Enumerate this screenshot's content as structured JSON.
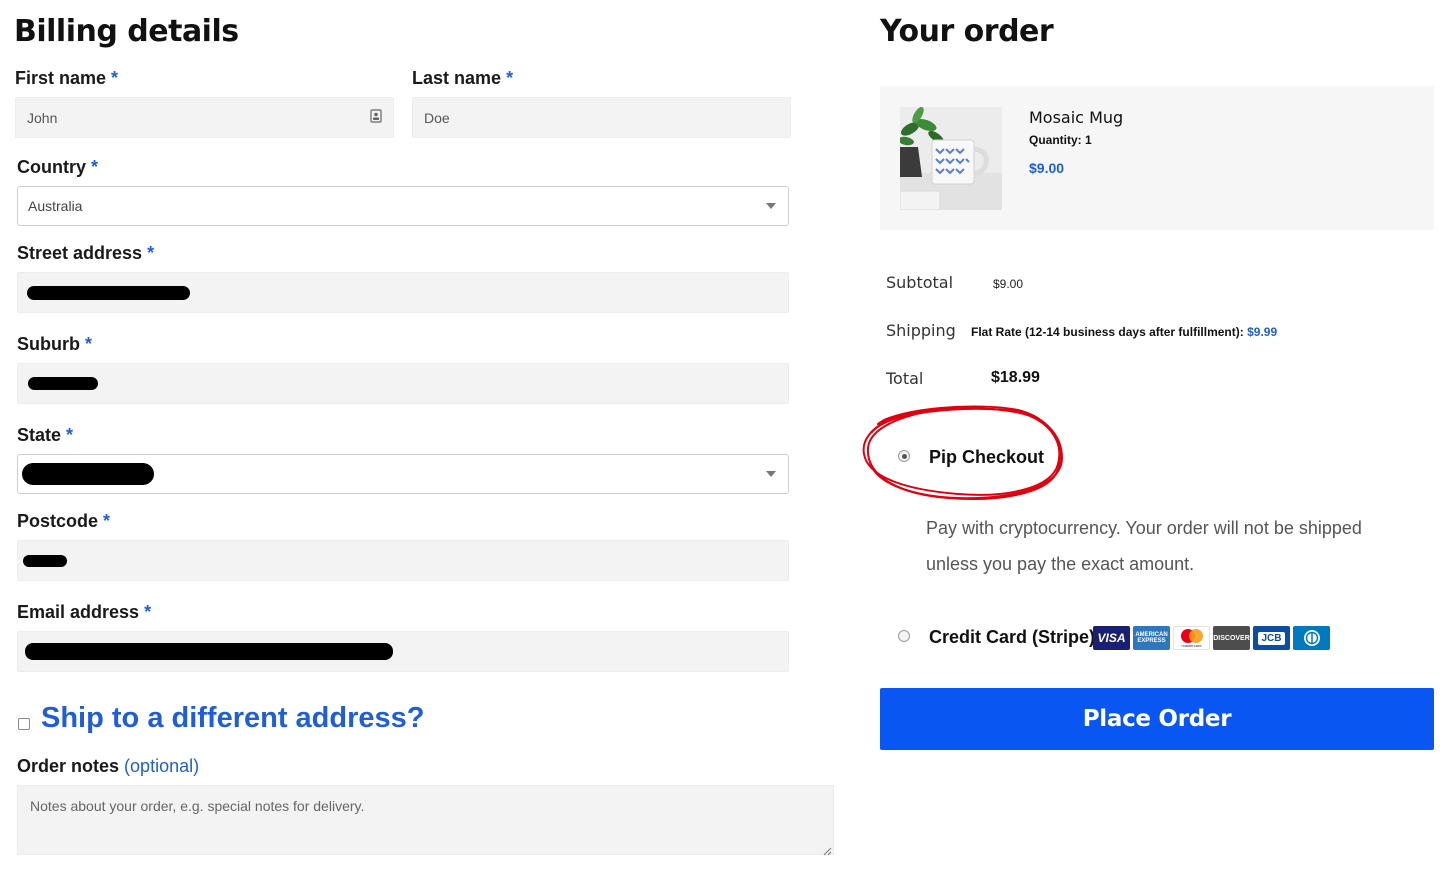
{
  "billing": {
    "title": "Billing details",
    "required_mark": "*",
    "first_name": {
      "label": "First name",
      "value": "John"
    },
    "last_name": {
      "label": "Last name",
      "value": "Doe"
    },
    "country": {
      "label": "Country",
      "value": "Australia"
    },
    "street": {
      "label": "Street address"
    },
    "suburb": {
      "label": "Suburb"
    },
    "state": {
      "label": "State"
    },
    "postcode": {
      "label": "Postcode"
    },
    "email": {
      "label": "Email address"
    },
    "ship_different": "Ship to a different address?",
    "order_notes": {
      "label": "Order notes",
      "optional": "(optional)",
      "placeholder": "Notes about your order, e.g. special notes for delivery."
    }
  },
  "order": {
    "title": "Your order",
    "product": {
      "name": "Mosaic Mug",
      "quantity": "Quantity: 1",
      "price": "$9.00"
    },
    "subtotal": {
      "label": "Subtotal",
      "value": "$9.00"
    },
    "shipping": {
      "label": "Shipping",
      "method": "Flat Rate (12-14 business days after fulfillment):",
      "price": "$9.99"
    },
    "total": {
      "label": "Total",
      "value": "$18.99"
    },
    "payment": {
      "pip": {
        "label": "Pip Checkout",
        "selected": true,
        "description_line1": "Pay with cryptocurrency. Your order will not be shipped",
        "description_line2": "unless you pay the exact amount."
      },
      "stripe": {
        "label": "Credit Card (Stripe)",
        "selected": false
      },
      "card_logos": [
        "VISA",
        "AMERICAN EXPRESS",
        "mastercard",
        "DISCOVER",
        "JCB",
        "Diners Club"
      ]
    },
    "place_order": "Place Order"
  },
  "annotation_color": "#e0000f",
  "accent_color": "#1f5ed6",
  "button_color": "#0a56f2"
}
